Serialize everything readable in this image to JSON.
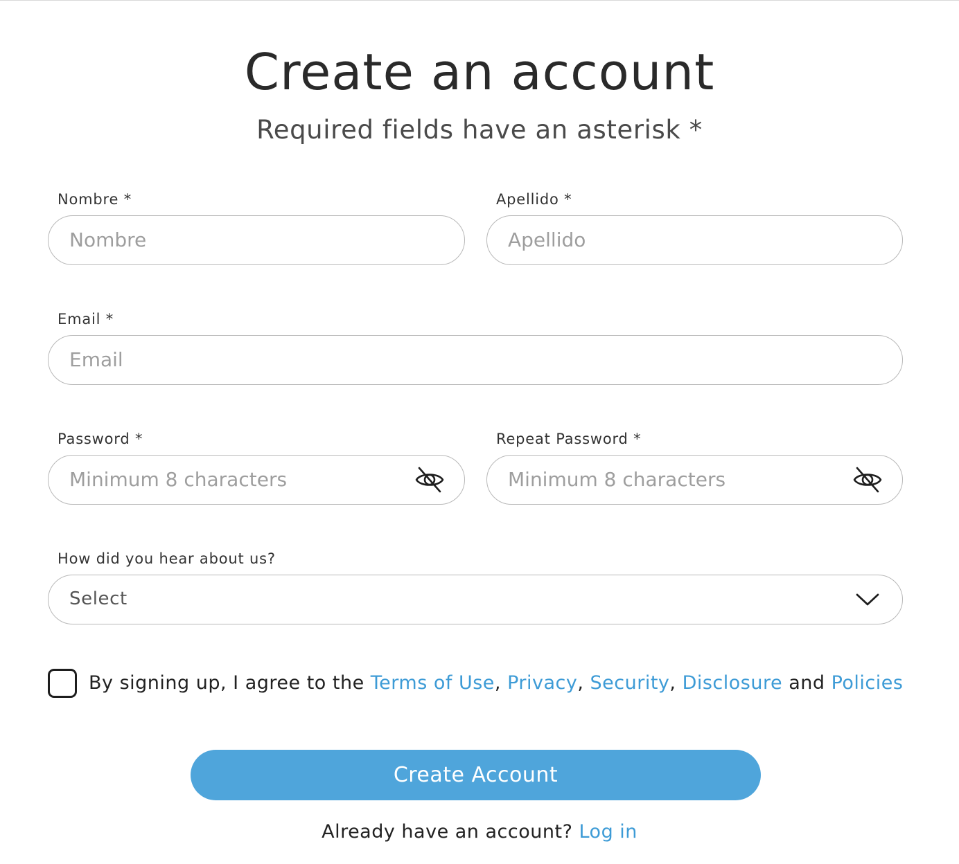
{
  "header": {
    "title": "Create an account",
    "subtitle": "Required fields have an asterisk *"
  },
  "form": {
    "first_name": {
      "label": "Nombre *",
      "placeholder": "Nombre",
      "value": ""
    },
    "last_name": {
      "label": "Apellido *",
      "placeholder": "Apellido",
      "value": ""
    },
    "email": {
      "label": "Email *",
      "placeholder": "Email",
      "value": ""
    },
    "password": {
      "label": "Password *",
      "placeholder": "Minimum 8 characters",
      "value": "",
      "icon": "eye-off-icon"
    },
    "repeat_password": {
      "label": "Repeat Password *",
      "placeholder": "Minimum 8 characters",
      "value": "",
      "icon": "eye-off-icon"
    },
    "referral": {
      "label": "How did you hear about us?",
      "selected": "Select",
      "icon": "chevron-down-icon"
    }
  },
  "agreement": {
    "checked": false,
    "prefix": "By signing up, I agree to the ",
    "terms": "Terms of Use",
    "sep1": ", ",
    "privacy": "Privacy",
    "sep2": ", ",
    "security": "Security",
    "sep3": ", ",
    "disclosure": "Disclosure",
    "and": " and ",
    "policies": "Policies"
  },
  "submit": {
    "label": "Create Account"
  },
  "footer": {
    "text": "Already have an account? ",
    "login_link": "Log in"
  },
  "colors": {
    "accent": "#4fa5db",
    "link": "#3d9bd6",
    "border": "#b8b8b8",
    "placeholder": "#9e9e9e"
  }
}
